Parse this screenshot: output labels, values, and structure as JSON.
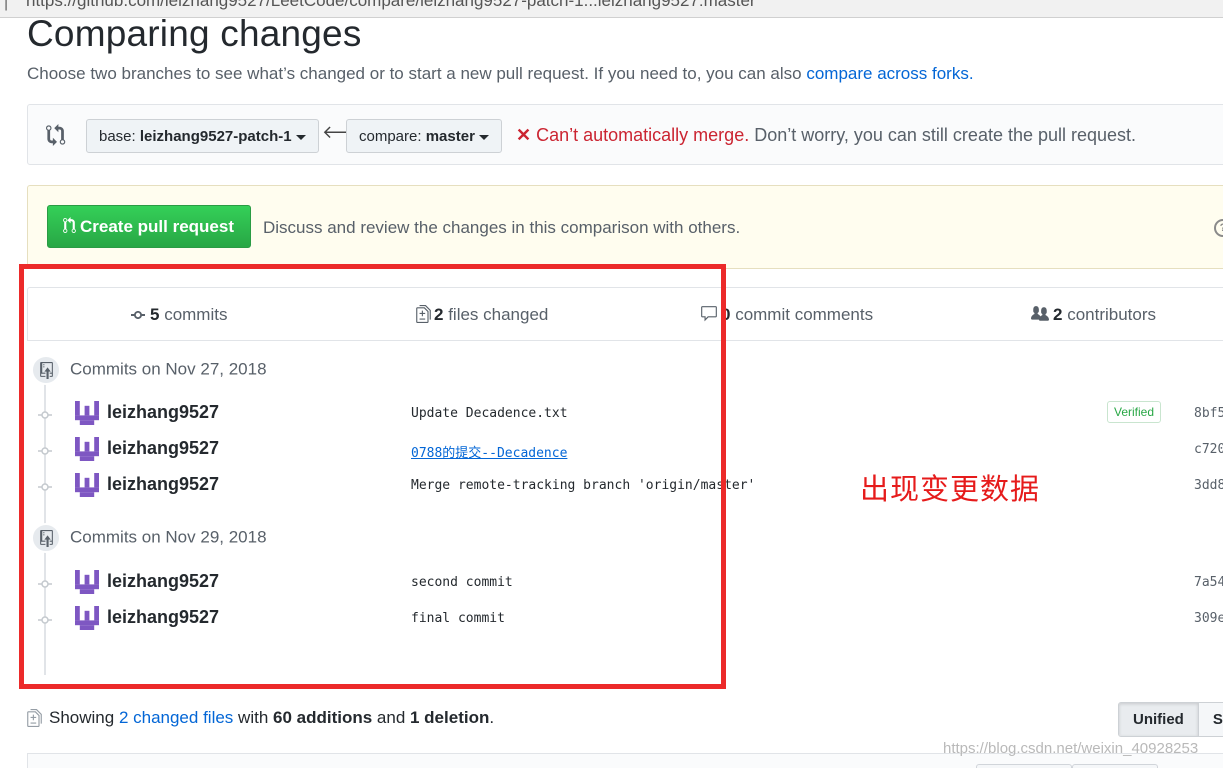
{
  "browser": {
    "url_separator": "|",
    "url": "https://github.com/leizhang9527/LeetCode/compare/leizhang9527-patch-1...leizhang9527:master"
  },
  "header": {
    "title": "Comparing changes",
    "subtitle": "Choose two branches to see what’s changed or to start a new pull request. If you need to, you can also ",
    "compare_forks_link": "compare across forks."
  },
  "range": {
    "base_prefix": "base: ",
    "base_branch": "leizhang9527-patch-1",
    "compare_prefix": "compare: ",
    "compare_branch": "master",
    "merge_error": "Can’t automatically merge.",
    "merge_note": " Don’t worry, you can still create the pull request."
  },
  "create_pr": {
    "button_label": "Create pull request",
    "description": "Discuss and review the changes in this comparison with others."
  },
  "summary": {
    "commits_count": "5",
    "commits_label": " commits",
    "files_count": "2",
    "files_label": " files changed",
    "comments_count": "0",
    "comments_label": " commit comments",
    "contributors_count": "2",
    "contributors_label": " contributors"
  },
  "commit_groups": [
    {
      "date_label": "Commits on Nov 27, 2018",
      "commits": [
        {
          "author": "leizhang9527",
          "message": "Update Decadence.txt",
          "verified": "Verified",
          "sha": "8bf5"
        },
        {
          "author": "leizhang9527",
          "message": "0788的提交--Decadence",
          "sha": "c720"
        },
        {
          "author": "leizhang9527",
          "message": "Merge remote-tracking branch 'origin/master'",
          "sha": "3dd8"
        }
      ]
    },
    {
      "date_label": "Commits on Nov 29, 2018",
      "commits": [
        {
          "author": "leizhang9527",
          "message": "second commit",
          "sha": "7a54"
        },
        {
          "author": "leizhang9527",
          "message": "final commit",
          "sha": "309e"
        }
      ]
    }
  ],
  "annotation": {
    "text": "出现变更数据",
    "color": "#e61b1b"
  },
  "files_summary": {
    "prefix": "Showing ",
    "changed_files_link": "2 changed files",
    "with": " with ",
    "additions": "60 additions",
    "and": " and ",
    "deletions": "1 deletion",
    "period": "."
  },
  "view_toggle": {
    "unified": "Unified",
    "split": "Sp"
  },
  "watermark": "https://blog.csdn.net/weixin_40928253",
  "colors": {
    "accent_link": "#0366d6",
    "success": "#28a745",
    "danger": "#cb2431"
  }
}
